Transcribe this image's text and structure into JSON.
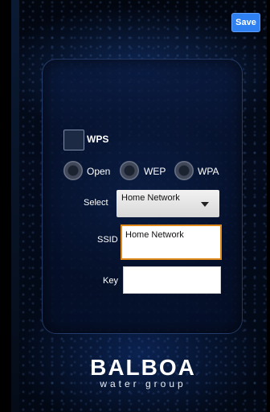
{
  "toolbar": {
    "save_label": "Save"
  },
  "wps": {
    "label": "WPS"
  },
  "security": {
    "options": [
      "Open",
      "WEP",
      "WPA"
    ]
  },
  "select": {
    "label": "Select",
    "value": "Home Network"
  },
  "ssid": {
    "label": "SSID",
    "value": "Home Network"
  },
  "key": {
    "label": "Key",
    "value": ""
  },
  "brand": {
    "name": "BALBOA",
    "sub": "water group"
  },
  "colors": {
    "accent": "#2f80f0",
    "focus_border": "#e08a1e"
  }
}
